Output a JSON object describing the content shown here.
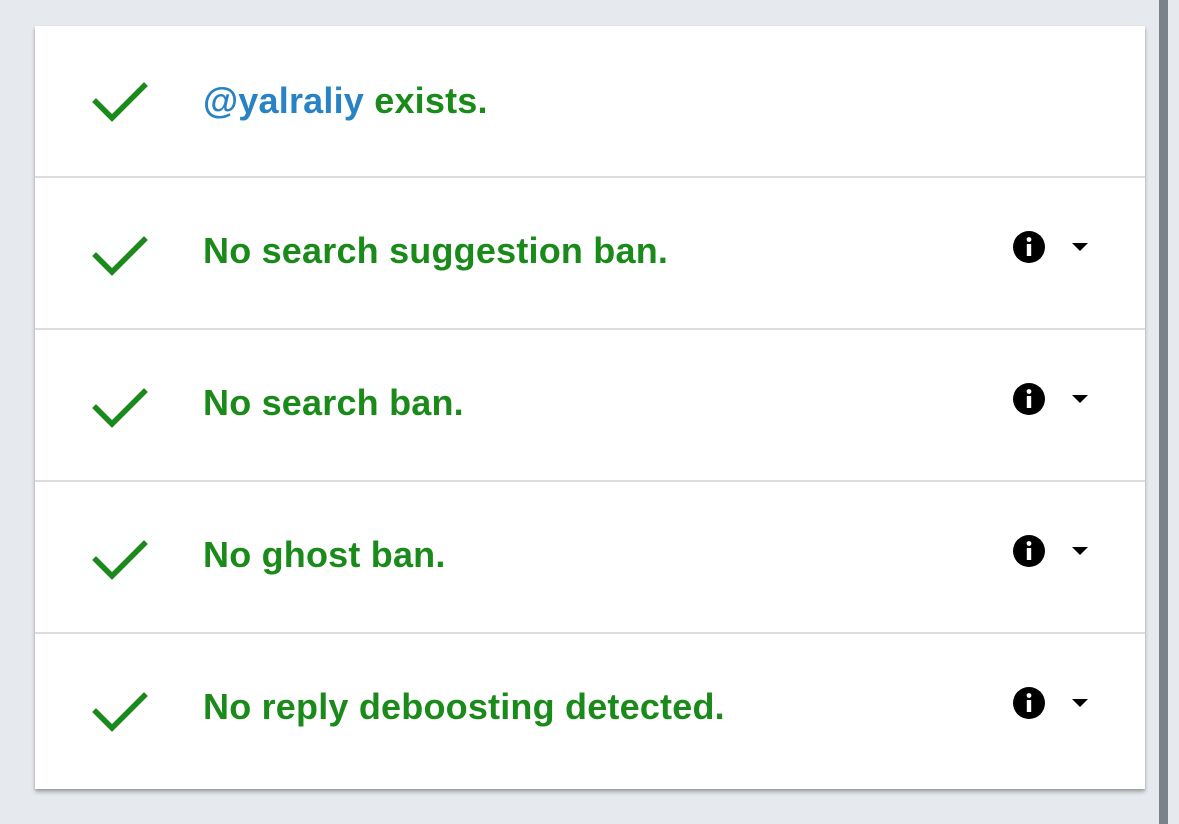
{
  "results": [
    {
      "handle": "@yalraliy",
      "text": " exists.",
      "has_info": false,
      "check_icon": "checkmark-icon"
    },
    {
      "text": "No search suggestion ban.",
      "has_info": true,
      "info_icon": "info-icon",
      "expand_icon": "chevron-down-icon",
      "check_icon": "checkmark-icon"
    },
    {
      "text": "No search ban.",
      "has_info": true,
      "info_icon": "info-icon",
      "expand_icon": "chevron-down-icon",
      "check_icon": "checkmark-icon"
    },
    {
      "text": "No ghost ban.",
      "has_info": true,
      "info_icon": "info-icon",
      "expand_icon": "chevron-down-icon",
      "check_icon": "checkmark-icon"
    },
    {
      "text": "No reply deboosting detected.",
      "has_info": true,
      "info_icon": "info-icon",
      "expand_icon": "chevron-down-icon",
      "check_icon": "checkmark-icon"
    }
  ],
  "colors": {
    "success_green": "#1a8a1a",
    "handle_blue": "#2882c4",
    "page_background": "#e6eaee",
    "card_background": "#ffffff",
    "divider": "#dcdcdc"
  }
}
